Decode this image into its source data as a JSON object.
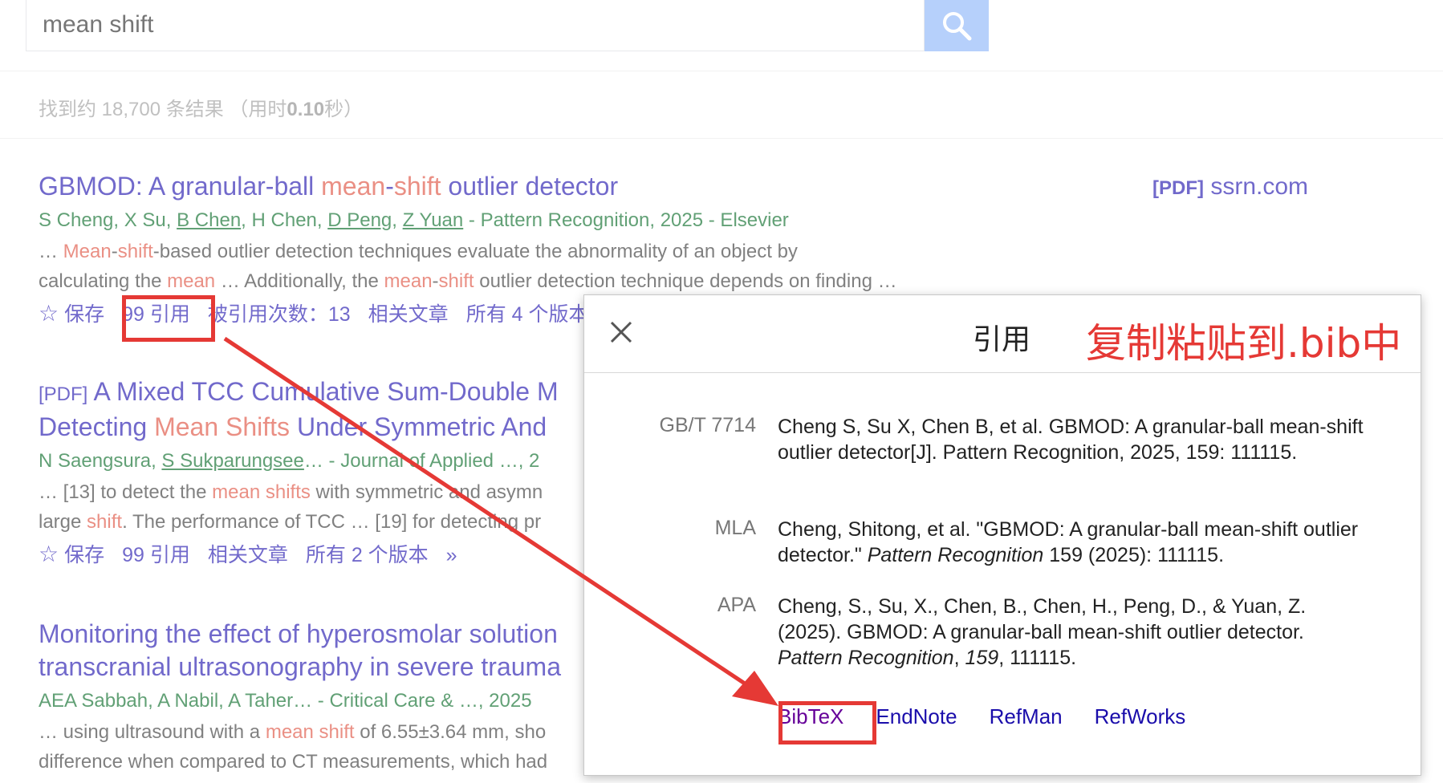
{
  "search": {
    "query": "mean shift"
  },
  "results_count": {
    "prefix": "找到约 18,700 条结果 （用时",
    "time": "0.10",
    "suffix": "秒）"
  },
  "results": [
    {
      "title_parts": [
        "GBMOD: A granular-ball ",
        "mean",
        "-",
        "shift",
        " outlier detector"
      ],
      "authors": {
        "plain1": "S Cheng, X Su, ",
        "link1": "B Chen",
        "plain2": ", H Chen, ",
        "link2": "D Peng",
        "plain3": ", ",
        "link3": "Z Yuan",
        "plain4": " - Pattern Recognition, 2025 - Elsevier"
      },
      "snippet_line1": [
        "… ",
        "Mean",
        "-",
        "shift",
        "-based outlier detection techniques evaluate the abnormality of an object by"
      ],
      "snippet_line2": [
        "calculating the ",
        "mean",
        " … Additionally, the ",
        "mean",
        "-",
        "shift",
        " outlier detection technique depends on finding …"
      ],
      "actions": {
        "save": "保存",
        "cite": "引用",
        "cited_by": "被引用次数：13",
        "related": "相关文章",
        "versions": "所有 4 个版本"
      },
      "pdf_side": {
        "tag": "[PDF]",
        "domain": "ssrn.com"
      }
    },
    {
      "pdf_tag": "[PDF]",
      "title_line1": [
        "A Mixed TCC Cumulative Sum-Double M"
      ],
      "title_line2": [
        "Detecting ",
        "Mean Shifts",
        " Under Symmetric And"
      ],
      "authors": {
        "plain1": "N Saengsura, ",
        "link1": "S Sukparungsee",
        "plain2": "… - Journal of Applied …, 2"
      },
      "snippet_line1": [
        "… [13] to detect the ",
        "mean shifts",
        " with symmetric and asymn"
      ],
      "snippet_line2": [
        "large ",
        "shift",
        ". The performance of TCC … [19] for detecting pr"
      ],
      "actions": {
        "save": "保存",
        "cite": "引用",
        "related": "相关文章",
        "versions": "所有 2 个版本",
        "more": "»"
      }
    },
    {
      "title_line1": "Monitoring the effect of hyperosmolar solution",
      "title_line2": "transcranial ultrasonography in severe trauma",
      "authors": "AEA Sabbah, A Nabil, A Taher… - Critical Care & …, 2025",
      "snippet_line1": [
        "… using ultrasound with a ",
        "mean shift",
        " of 6.55±3.64 mm, sho"
      ],
      "snippet_line2": [
        "difference when compared to CT measurements, which had"
      ]
    }
  ],
  "modal": {
    "title": "引用",
    "annotation": "复制粘贴到.bib中",
    "citations": [
      {
        "label": "GB/T 7714",
        "text": "Cheng S, Su X, Chen B, et al. GBMOD: A granular-ball mean-shift outlier detector[J]. Pattern Recognition, 2025, 159: 111115."
      },
      {
        "label": "MLA",
        "text_before": "Cheng, Shitong, et al. \"GBMOD: A granular-ball mean-shift outlier detector.\" ",
        "italic": "Pattern Recognition",
        "text_after": " 159 (2025): 111115."
      },
      {
        "label": "APA",
        "text_before": "Cheng, S., Su, X., Chen, B., Chen, H., Peng, D., & Yuan, Z. (2025). GBMOD: A granular-ball mean-shift outlier detector. ",
        "italic": "Pattern Recognition",
        "text_mid": ", ",
        "italic2": "159",
        "text_after": ", 111115."
      }
    ],
    "exports": [
      "BibTeX",
      "EndNote",
      "RefMan",
      "RefWorks"
    ]
  },
  "colors": {
    "link": "#1a0dab",
    "highlight": "#dd4b39",
    "author": "#006621",
    "annotation": "#e53935",
    "search_button": "#8ab4f8"
  }
}
